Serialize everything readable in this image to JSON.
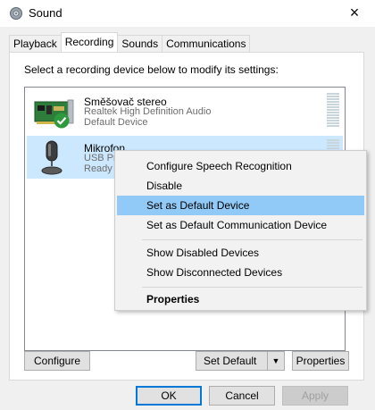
{
  "window": {
    "title": "Sound",
    "close_glyph": "×"
  },
  "tabs": [
    {
      "label": "Playback"
    },
    {
      "label": "Recording"
    },
    {
      "label": "Sounds"
    },
    {
      "label": "Communications"
    }
  ],
  "instruction": "Select a recording device below to modify its settings:",
  "devices": [
    {
      "name": "Směšovač stereo",
      "description": "Realtek High Definition Audio",
      "status": "Default Device",
      "icon": "sound-card-icon",
      "badge": "default-check-icon"
    },
    {
      "name": "Mikrofon",
      "description": "USB Pr",
      "status": "Ready",
      "icon": "microphone-icon",
      "selected": true
    }
  ],
  "context_menu": {
    "items": [
      {
        "label": "Configure Speech Recognition"
      },
      {
        "label": "Disable"
      },
      {
        "label": "Set as Default Device",
        "highlighted": true
      },
      {
        "label": "Set as Default Communication Device"
      },
      {
        "label": "Show Disabled Devices"
      },
      {
        "label": "Show Disconnected Devices"
      },
      {
        "label": "Properties",
        "bold": true
      }
    ]
  },
  "panel_buttons": {
    "configure": "Configure",
    "set_default": "Set Default",
    "properties": "Properties"
  },
  "dialog_buttons": {
    "ok": "OK",
    "cancel": "Cancel",
    "apply": "Apply"
  },
  "colors": {
    "selection": "#cce8ff",
    "menu_highlight": "#91c9f7",
    "default_check": "#2e9a3f"
  }
}
